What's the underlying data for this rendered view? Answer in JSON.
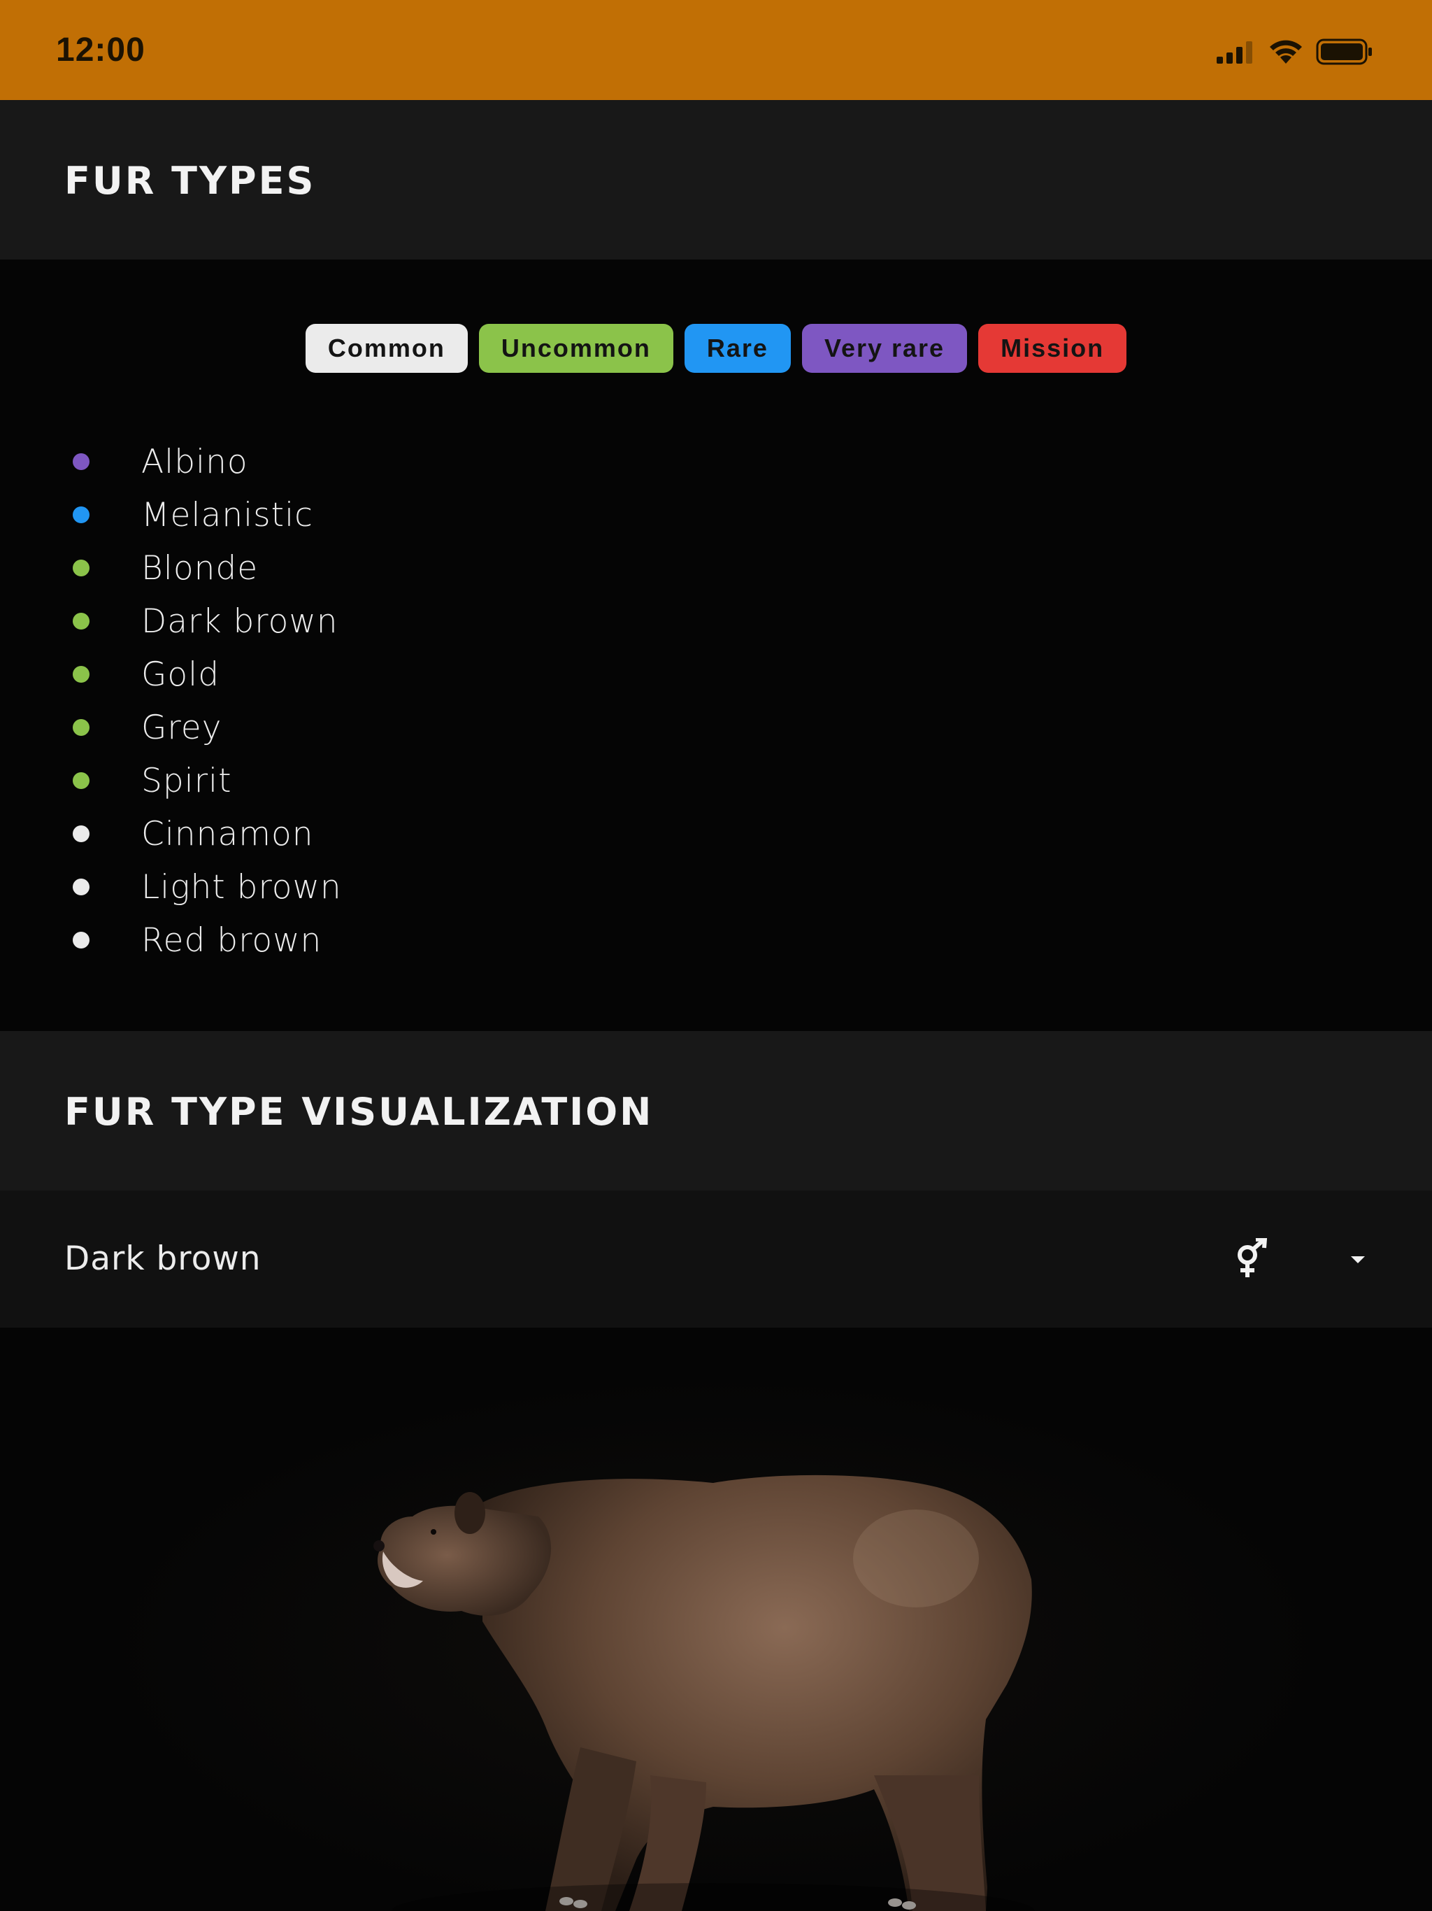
{
  "status_bar": {
    "time": "12:00",
    "background": "#c16f05",
    "icons": [
      "cellular-signal-icon",
      "wifi-icon",
      "battery-icon"
    ]
  },
  "fur_types_section": {
    "title": "FUR TYPES"
  },
  "rarity_legend": [
    {
      "label": "Common",
      "color": "#ebebeb"
    },
    {
      "label": "Uncommon",
      "color": "#8bc34a"
    },
    {
      "label": "Rare",
      "color": "#2196f3"
    },
    {
      "label": "Very rare",
      "color": "#7e57c2"
    },
    {
      "label": "Mission",
      "color": "#e53935"
    }
  ],
  "fur_list": [
    {
      "name": "Albino",
      "rarity": "Very rare",
      "color": "#7e57c2"
    },
    {
      "name": "Melanistic",
      "rarity": "Rare",
      "color": "#2196f3"
    },
    {
      "name": "Blonde",
      "rarity": "Uncommon",
      "color": "#8bc34a"
    },
    {
      "name": "Dark brown",
      "rarity": "Uncommon",
      "color": "#8bc34a"
    },
    {
      "name": "Gold",
      "rarity": "Uncommon",
      "color": "#8bc34a"
    },
    {
      "name": "Grey",
      "rarity": "Uncommon",
      "color": "#8bc34a"
    },
    {
      "name": "Spirit",
      "rarity": "Uncommon",
      "color": "#8bc34a"
    },
    {
      "name": "Cinnamon",
      "rarity": "Common",
      "color": "#ebebeb"
    },
    {
      "name": "Light brown",
      "rarity": "Common",
      "color": "#ebebeb"
    },
    {
      "name": "Red brown",
      "rarity": "Common",
      "color": "#ebebeb"
    }
  ],
  "visualization_section": {
    "title": "FUR TYPE VISUALIZATION",
    "selected_fur": "Dark brown",
    "gender_icon": "male-female-icon",
    "dropdown_icon": "dropdown-arrow-icon"
  }
}
